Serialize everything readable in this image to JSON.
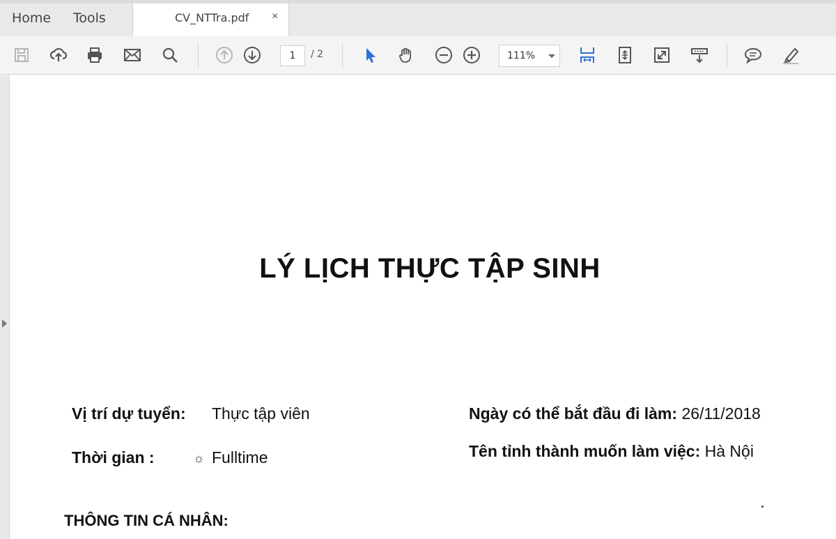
{
  "app": {
    "tabs": {
      "home": "Home",
      "tools": "Tools"
    },
    "document_tab": {
      "filename": "CV_NTTra.pdf",
      "close_glyph": "×"
    }
  },
  "toolbar": {
    "icons": [
      "save-icon",
      "upload-cloud-icon",
      "print-icon",
      "email-icon",
      "search-icon",
      "prev-page-icon",
      "next-page-icon",
      "select-cursor-icon",
      "hand-tool-icon",
      "zoom-out-icon",
      "zoom-in-icon",
      "fit-width-icon",
      "fit-page-icon",
      "fullscreen-icon",
      "read-mode-icon",
      "comment-icon",
      "highlight-icon"
    ],
    "page_current": "1",
    "page_total": "/ 2",
    "zoom": "111%",
    "accent_color": "#2a6fd6"
  },
  "document": {
    "title": "LÝ LỊCH THỰC TẬP SINH",
    "position_label": "Vị trí dự tuyển:",
    "position_value": "Thực tập viên",
    "time_label": "Thời gian :",
    "time_value": "Fulltime",
    "start_label": "Ngày có thể bắt đầu đi làm:",
    "start_value": "26/11/2018",
    "city_label": "Tên tỉnh thành muốn làm việc:",
    "city_value": "Hà Nội",
    "section_personal": "THÔNG TIN CÁ NHÂN:"
  }
}
